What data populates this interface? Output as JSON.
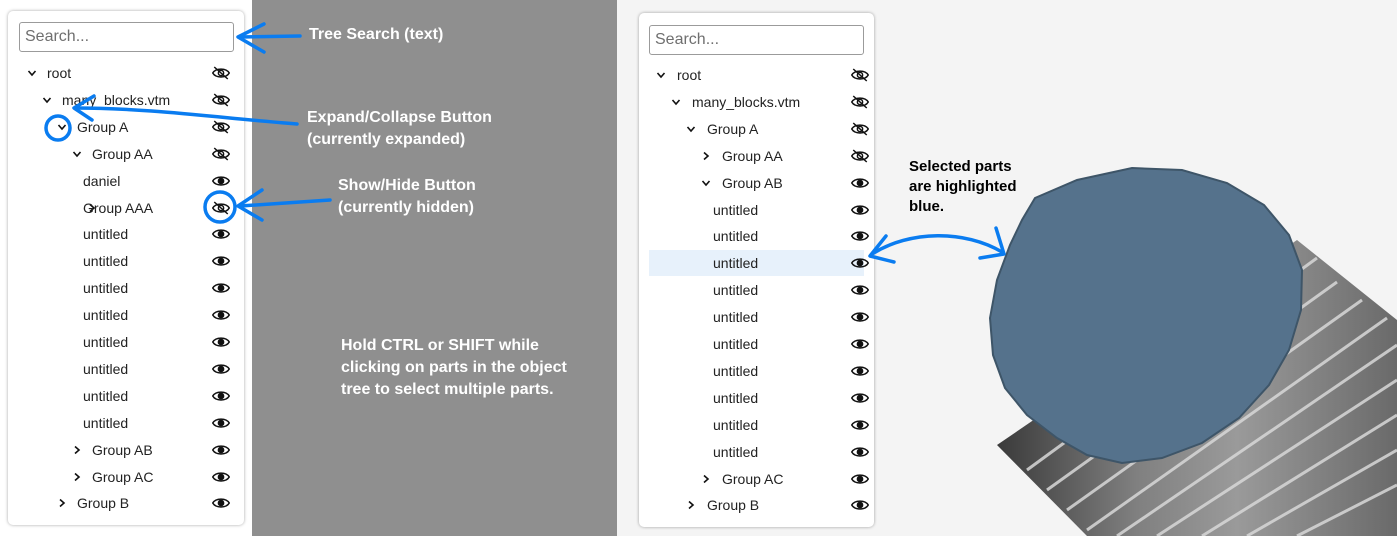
{
  "left_panel": {
    "search_placeholder": "Search...",
    "rows": [
      {
        "label": "root",
        "indent": 0,
        "chevron": "down",
        "visible": false
      },
      {
        "label": "many_blocks.vtm",
        "indent": 1,
        "chevron": "down",
        "visible": false
      },
      {
        "label": "Group A",
        "indent": 2,
        "chevron": "down",
        "visible": false
      },
      {
        "label": "Group AA",
        "indent": 3,
        "chevron": "down",
        "visible": false
      },
      {
        "label": "daniel",
        "indent": 4,
        "chevron": "none",
        "visible": true
      },
      {
        "label": "Group AAA",
        "indent": 4,
        "chevron": "right",
        "visible": false
      },
      {
        "label": "untitled",
        "indent": 4,
        "chevron": "none",
        "visible": true
      },
      {
        "label": "untitled",
        "indent": 4,
        "chevron": "none",
        "visible": true
      },
      {
        "label": "untitled",
        "indent": 4,
        "chevron": "none",
        "visible": true
      },
      {
        "label": "untitled",
        "indent": 4,
        "chevron": "none",
        "visible": true
      },
      {
        "label": "untitled",
        "indent": 4,
        "chevron": "none",
        "visible": true
      },
      {
        "label": "untitled",
        "indent": 4,
        "chevron": "none",
        "visible": true
      },
      {
        "label": "untitled",
        "indent": 4,
        "chevron": "none",
        "visible": true
      },
      {
        "label": "untitled",
        "indent": 4,
        "chevron": "none",
        "visible": true
      },
      {
        "label": "Group AB",
        "indent": 3,
        "chevron": "right",
        "visible": true
      },
      {
        "label": "Group AC",
        "indent": 3,
        "chevron": "right",
        "visible": true
      },
      {
        "label": "Group B",
        "indent": 2,
        "chevron": "right",
        "visible": true
      }
    ]
  },
  "right_panel": {
    "search_placeholder": "Search...",
    "rows": [
      {
        "label": "root",
        "indent": 0,
        "chevron": "down",
        "visible": false,
        "selected": false
      },
      {
        "label": "many_blocks.vtm",
        "indent": 1,
        "chevron": "down",
        "visible": false,
        "selected": false
      },
      {
        "label": "Group A",
        "indent": 2,
        "chevron": "down",
        "visible": false,
        "selected": false
      },
      {
        "label": "Group AA",
        "indent": 3,
        "chevron": "right",
        "visible": false,
        "selected": false
      },
      {
        "label": "Group AB",
        "indent": 3,
        "chevron": "down",
        "visible": true,
        "selected": false
      },
      {
        "label": "untitled",
        "indent": 4,
        "chevron": "none",
        "visible": true,
        "selected": false
      },
      {
        "label": "untitled",
        "indent": 4,
        "chevron": "none",
        "visible": true,
        "selected": false
      },
      {
        "label": "untitled",
        "indent": 4,
        "chevron": "none",
        "visible": true,
        "selected": true
      },
      {
        "label": "untitled",
        "indent": 4,
        "chevron": "none",
        "visible": true,
        "selected": false
      },
      {
        "label": "untitled",
        "indent": 4,
        "chevron": "none",
        "visible": true,
        "selected": false
      },
      {
        "label": "untitled",
        "indent": 4,
        "chevron": "none",
        "visible": true,
        "selected": false
      },
      {
        "label": "untitled",
        "indent": 4,
        "chevron": "none",
        "visible": true,
        "selected": false
      },
      {
        "label": "untitled",
        "indent": 4,
        "chevron": "none",
        "visible": true,
        "selected": false
      },
      {
        "label": "untitled",
        "indent": 4,
        "chevron": "none",
        "visible": true,
        "selected": false
      },
      {
        "label": "untitled",
        "indent": 4,
        "chevron": "none",
        "visible": true,
        "selected": false
      },
      {
        "label": "Group AC",
        "indent": 3,
        "chevron": "right",
        "visible": true,
        "selected": false
      },
      {
        "label": "Group B",
        "indent": 2,
        "chevron": "right",
        "visible": true,
        "selected": false
      }
    ]
  },
  "annotations": {
    "tree_search": "Tree Search (text)",
    "expand_line1": "Expand/Collapse Button",
    "expand_line2": "(currently expanded)",
    "showhide_line1": "Show/Hide Button",
    "showhide_line2": "(currently hidden)",
    "multi_line1": "Hold CTRL or SHIFT while",
    "multi_line2": "clicking on parts in the object",
    "multi_line3": "tree to select multiple parts.",
    "selected_line1": "Selected parts",
    "selected_line2": "are highlighted",
    "selected_line3": "blue."
  },
  "icons": {
    "visible": "eye-icon",
    "hidden": "eye-off-icon",
    "expanded": "chevron-down-icon",
    "collapsed": "chevron-right-icon"
  },
  "colors": {
    "annotation_blue": "#0a7cf0",
    "selected_row": "#e7f1fb",
    "gray_bg": "#8f8f8f",
    "cylinder_top": "#55728c"
  }
}
